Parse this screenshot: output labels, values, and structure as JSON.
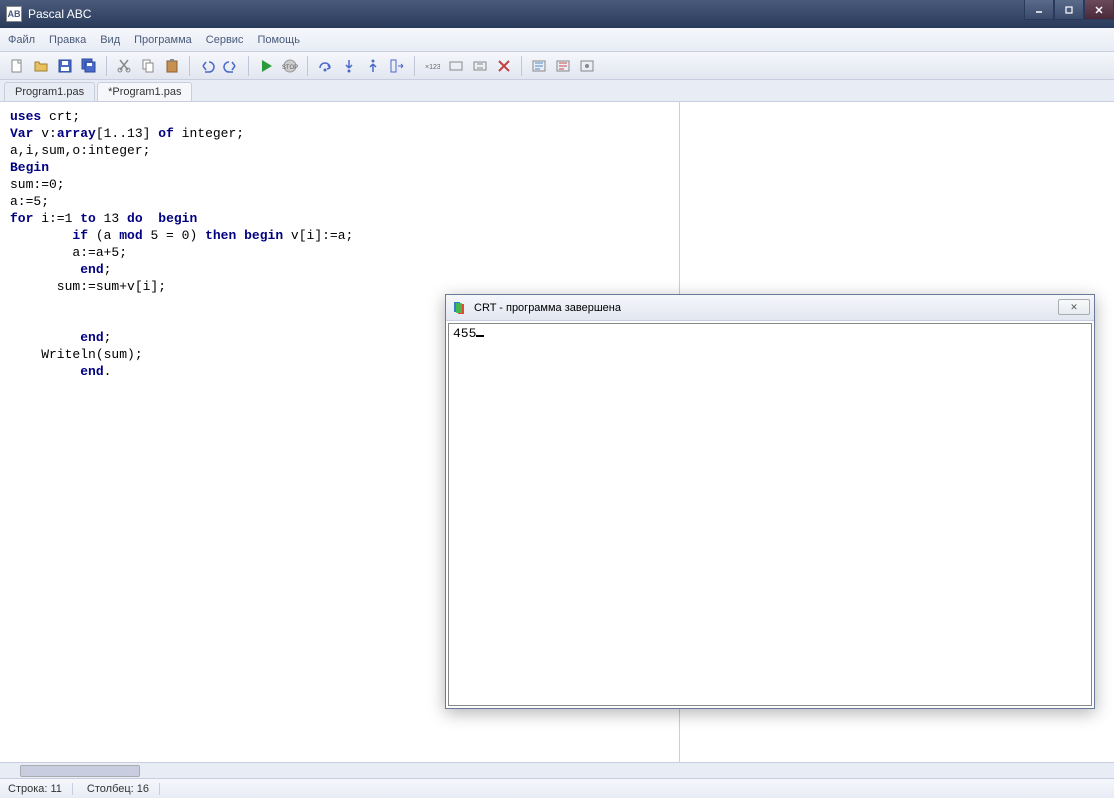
{
  "window": {
    "title": "Pascal ABC",
    "app_icon_text": "AB"
  },
  "menu": {
    "file": "Файл",
    "edit": "Правка",
    "view": "Вид",
    "program": "Программа",
    "service": "Сервис",
    "help": "Помощь"
  },
  "toolbar_icons": [
    "new-file-icon",
    "open-file-icon",
    "save-icon",
    "save-all-icon",
    "sep",
    "cut-icon",
    "copy-icon",
    "paste-icon",
    "sep",
    "undo-icon",
    "redo-icon",
    "sep",
    "run-icon",
    "stop-icon",
    "sep",
    "step-over-icon",
    "step-into-icon",
    "step-out-icon",
    "run-to-icon",
    "sep",
    "breakpoint-icon",
    "watch-icon",
    "eval-icon",
    "clear-icon",
    "sep",
    "compile-icon",
    "build-icon",
    "options-icon"
  ],
  "tabs": [
    {
      "label": "Program1.pas",
      "active": false
    },
    {
      "label": "*Program1.pas",
      "active": true
    }
  ],
  "code_lines": [
    {
      "t": "uses crt;",
      "parts": [
        [
          "kw",
          "uses"
        ],
        [
          "",
          " crt;"
        ]
      ]
    },
    {
      "t": "Var v:array[1..13] of integer;",
      "parts": [
        [
          "kw",
          "Var"
        ],
        [
          "",
          " v:"
        ],
        [
          "kw",
          "array"
        ],
        [
          "",
          "[1..13] "
        ],
        [
          "kw",
          "of"
        ],
        [
          "",
          " integer;"
        ]
      ]
    },
    {
      "t": "a,i,sum,o:integer;",
      "parts": [
        [
          "",
          "a,i,sum,o:integer;"
        ]
      ]
    },
    {
      "t": "Begin",
      "parts": [
        [
          "kw",
          "Begin"
        ]
      ]
    },
    {
      "t": "sum:=0;",
      "parts": [
        [
          "",
          "sum:=0;"
        ]
      ]
    },
    {
      "t": "a:=5;",
      "parts": [
        [
          "",
          "a:=5;"
        ]
      ]
    },
    {
      "t": "for i:=1 to 13 do  begin",
      "parts": [
        [
          "kw",
          "for"
        ],
        [
          "",
          " i:=1 "
        ],
        [
          "kw",
          "to"
        ],
        [
          "",
          " 13 "
        ],
        [
          "kw",
          "do"
        ],
        [
          "",
          "  "
        ],
        [
          "kw",
          "begin"
        ]
      ]
    },
    {
      "t": "        if (a mod 5 = 0) then begin v[i]:=a;",
      "parts": [
        [
          "",
          "        "
        ],
        [
          "kw",
          "if"
        ],
        [
          "",
          " (a "
        ],
        [
          "kw",
          "mod"
        ],
        [
          "",
          " 5 = 0) "
        ],
        [
          "kw",
          "then"
        ],
        [
          "",
          " "
        ],
        [
          "kw",
          "begin"
        ],
        [
          "",
          " v[i]:=a;"
        ]
      ]
    },
    {
      "t": "        a:=a+5;",
      "parts": [
        [
          "",
          "        a:=a+5;"
        ]
      ]
    },
    {
      "t": "         end;",
      "parts": [
        [
          "",
          "         "
        ],
        [
          "kw",
          "end"
        ],
        [
          "",
          ";"
        ]
      ]
    },
    {
      "t": "      sum:=sum+v[i];",
      "parts": [
        [
          "",
          "      sum:=sum+v[i];"
        ]
      ]
    },
    {
      "t": "",
      "parts": [
        [
          "",
          ""
        ]
      ]
    },
    {
      "t": "",
      "parts": [
        [
          "",
          ""
        ]
      ]
    },
    {
      "t": "         end;",
      "parts": [
        [
          "",
          "         "
        ],
        [
          "kw",
          "end"
        ],
        [
          "",
          ";"
        ]
      ]
    },
    {
      "t": "    Writeln(sum);",
      "parts": [
        [
          "",
          "    Writeln(sum);"
        ]
      ]
    },
    {
      "t": "         end.",
      "parts": [
        [
          "",
          "         "
        ],
        [
          "kw",
          "end"
        ],
        [
          "",
          "."
        ]
      ]
    }
  ],
  "statusbar": {
    "line": "Строка: 11",
    "col": "Столбец: 16"
  },
  "crt": {
    "title": "CRT - программа завершена",
    "output": "455",
    "close": "✕"
  }
}
